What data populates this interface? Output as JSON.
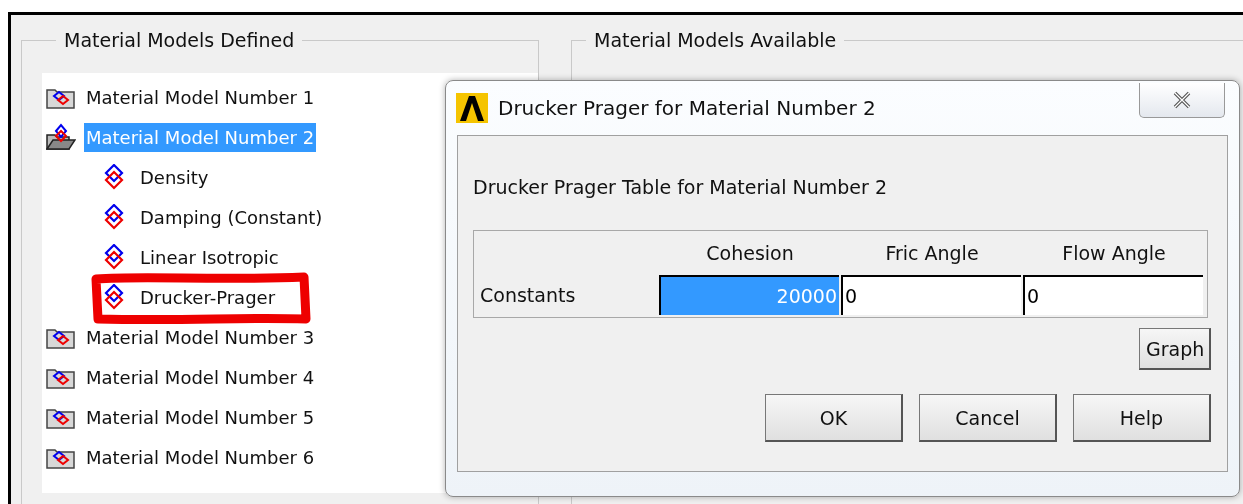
{
  "defined_group": {
    "title": "Material Models Defined",
    "tree": [
      {
        "label": "Material Model Number 1",
        "kind": "model",
        "selected": false,
        "expanded": false
      },
      {
        "label": "Material Model Number 2",
        "kind": "model",
        "selected": true,
        "expanded": true,
        "children": [
          {
            "label": "Density",
            "kind": "property",
            "selected": false,
            "annotated": false
          },
          {
            "label": "Damping (Constant)",
            "kind": "property",
            "selected": false,
            "annotated": false
          },
          {
            "label": "Linear Isotropic",
            "kind": "property",
            "selected": false,
            "annotated": false
          },
          {
            "label": "Drucker-Prager",
            "kind": "property",
            "selected": false,
            "annotated": true
          }
        ]
      },
      {
        "label": "Material Model Number 3",
        "kind": "model",
        "selected": false,
        "expanded": false
      },
      {
        "label": "Material Model Number 4",
        "kind": "model",
        "selected": false,
        "expanded": false
      },
      {
        "label": "Material Model Number 5",
        "kind": "model",
        "selected": false,
        "expanded": false
      },
      {
        "label": "Material Model Number 6",
        "kind": "model",
        "selected": false,
        "expanded": false
      }
    ]
  },
  "available_group": {
    "title": "Material Models Available"
  },
  "dialog": {
    "title": "Drucker Prager for Material Number 2",
    "heading": "Drucker Prager Table  for Material Number 2",
    "table": {
      "columns": [
        "Cohesion",
        "Fric Angle",
        "Flow Angle"
      ],
      "row_label": "Constants",
      "cells": [
        {
          "value": "20000",
          "selected": true
        },
        {
          "value": "0",
          "selected": false
        },
        {
          "value": "0",
          "selected": false
        }
      ]
    },
    "graph_button": "Graph",
    "buttons": [
      "OK",
      "Cancel",
      "Help"
    ]
  }
}
